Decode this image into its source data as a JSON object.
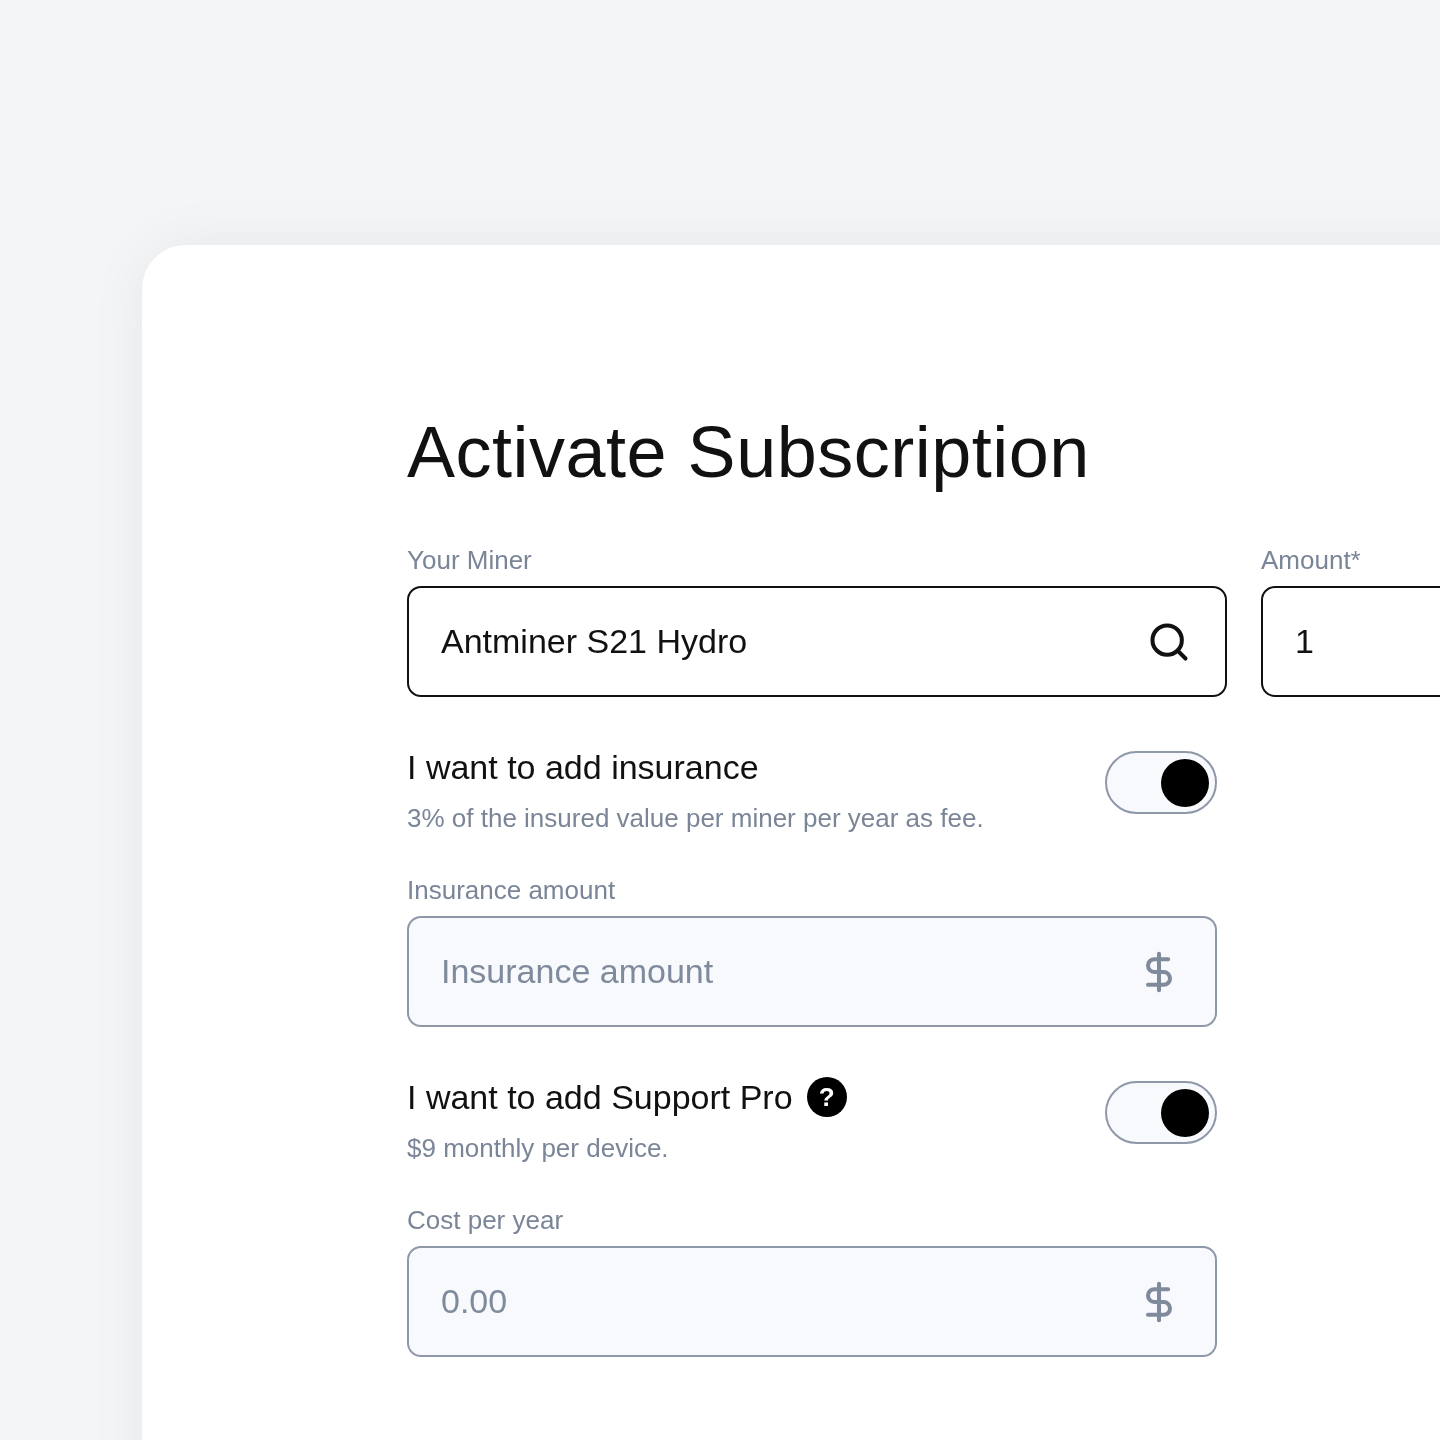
{
  "title": "Activate Subscription",
  "miner": {
    "label": "Your Miner",
    "value": "Antminer S21 Hydro"
  },
  "amount": {
    "label": "Amount*",
    "value": "1"
  },
  "sections": [
    {
      "kind": "toggle",
      "label": "I want to add insurance",
      "note": "3% of the insured value per miner per year as fee.",
      "on": true
    },
    {
      "kind": "field",
      "label": "Insurance amount",
      "placeholder": "Insurance amount"
    },
    {
      "kind": "toggle",
      "label": "I want to add Support Pro",
      "help": "?",
      "note": "$9 monthly per device.",
      "on": true
    },
    {
      "kind": "field",
      "label": "Cost per year",
      "placeholder": "0.00"
    }
  ]
}
